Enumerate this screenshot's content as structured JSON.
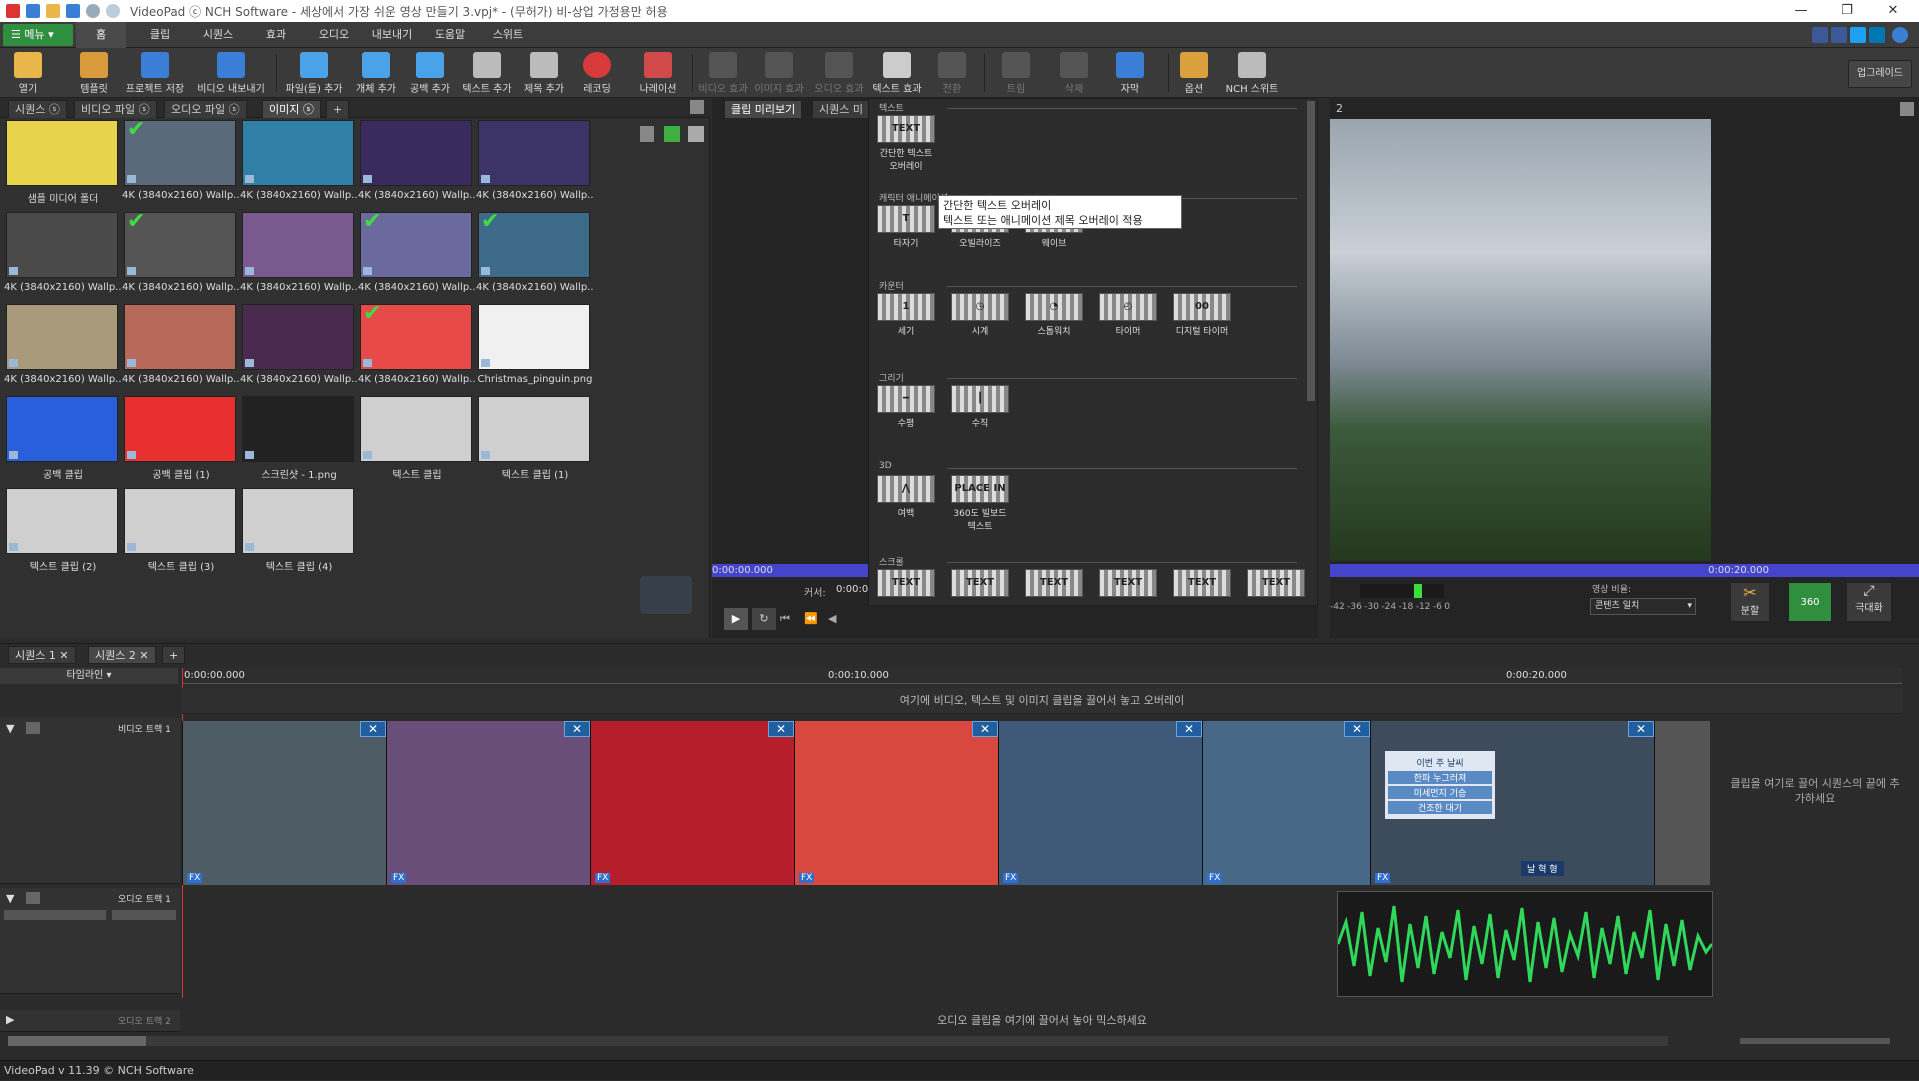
{
  "window": {
    "title": "VideoPad ⓒ NCH Software - 세상에서 가장 쉬운 영상 만들기 3.vpj* - (무허가) 비-상업 가정용만 허용",
    "controls": [
      "—",
      "❐",
      "✕"
    ]
  },
  "menu": {
    "main_button": "☰ 메뉴 ▾",
    "tabs": [
      "홈",
      "클립",
      "시퀀스",
      "효과",
      "오디오",
      "내보내기",
      "도움말",
      "스위트"
    ],
    "active_tab": "홈"
  },
  "toolbar": {
    "items": [
      {
        "label": "열기",
        "icon": "folder-open-icon",
        "color": "#e8b64a",
        "enabled": true
      },
      {
        "label": "템플릿",
        "icon": "template-icon",
        "color": "#d99a3b",
        "enabled": true
      },
      {
        "label": "프로젝트 저장",
        "icon": "save-icon",
        "color": "#3a7fd5",
        "enabled": true
      },
      {
        "label": "비디오 내보내기",
        "icon": "export-video-icon",
        "color": "#3a7fd5",
        "enabled": true
      },
      {
        "label": "파일(들) 추가",
        "icon": "add-files-icon",
        "color": "#4aa3e8",
        "enabled": true
      },
      {
        "label": "개체 추가",
        "icon": "add-object-icon",
        "color": "#4aa3e8",
        "enabled": true
      },
      {
        "label": "공백 추가",
        "icon": "add-blank-icon",
        "color": "#4aa3e8",
        "enabled": true
      },
      {
        "label": "텍스트 추가",
        "icon": "add-text-icon",
        "color": "#bbbbbb",
        "enabled": true
      },
      {
        "label": "제목 추가",
        "icon": "add-title-icon",
        "color": "#bbbbbb",
        "enabled": true
      },
      {
        "label": "레코딩",
        "icon": "record-icon",
        "color": "#d63a3a",
        "enabled": true
      },
      {
        "label": "나레이션",
        "icon": "narration-mic-icon",
        "color": "#d04a4a",
        "enabled": true
      },
      {
        "label": "비디오 효과",
        "icon": "video-effects-icon",
        "color": "#888888",
        "enabled": false
      },
      {
        "label": "이미지 효과",
        "icon": "image-effects-icon",
        "color": "#888888",
        "enabled": false
      },
      {
        "label": "오디오 효과",
        "icon": "audio-effects-icon",
        "color": "#888888",
        "enabled": false
      },
      {
        "label": "텍스트 효과",
        "icon": "text-effects-icon",
        "color": "#cccccc",
        "enabled": true
      },
      {
        "label": "전환",
        "icon": "transition-icon",
        "color": "#888888",
        "enabled": false
      },
      {
        "label": "트림",
        "icon": "trim-icon",
        "color": "#888888",
        "enabled": false
      },
      {
        "label": "삭제",
        "icon": "delete-icon",
        "color": "#888888",
        "enabled": false
      },
      {
        "label": "자막",
        "icon": "subtitle-icon",
        "color": "#3a7fd5",
        "enabled": true
      },
      {
        "label": "옵션",
        "icon": "options-icon",
        "color": "#d9a03b",
        "enabled": true
      },
      {
        "label": "NCH 스위트",
        "icon": "nch-suite-icon",
        "color": "#bbbbbb",
        "enabled": true
      }
    ],
    "upgrade_label": "업그레이드"
  },
  "bin": {
    "tabs": [
      {
        "label": "시퀀스",
        "count": "ⓢ"
      },
      {
        "label": "비디오 파일",
        "count": "ⓢ"
      },
      {
        "label": "오디오 파일",
        "count": "ⓢ"
      },
      {
        "label": "이미지",
        "count": "ⓢ"
      }
    ],
    "add_tab": "+",
    "items": [
      {
        "label": "샘플 미디어 폴더",
        "color": "#e8d44a",
        "checked": false
      },
      {
        "label": "4K (3840x2160) Wallp...",
        "color": "#5a6a7a",
        "checked": true
      },
      {
        "label": "4K (3840x2160) Wallp...",
        "color": "#2f7fa6",
        "checked": false
      },
      {
        "label": "4K (3840x2160) Wallp...",
        "color": "#3a2a5e",
        "checked": false
      },
      {
        "label": "4K (3840x2160) Wallp...",
        "color": "#3c3366",
        "checked": false
      },
      {
        "label": "4K (3840x2160) Wallp...",
        "color": "#4a4a4a",
        "checked": false
      },
      {
        "label": "4K (3840x2160) Wallp...",
        "color": "#555555",
        "checked": true
      },
      {
        "label": "4K (3840x2160) Wallp...",
        "color": "#7a5a8e",
        "checked": false
      },
      {
        "label": "4K (3840x2160) Wallp...",
        "color": "#6a6a9e",
        "checked": true
      },
      {
        "label": "4K (3840x2160) Wallp...",
        "color": "#3e6a8a",
        "checked": true
      },
      {
        "label": "4K (3840x2160) Wallp...",
        "color": "#a89a7a",
        "checked": false
      },
      {
        "label": "4K (3840x2160) Wallp...",
        "color": "#b86a5a",
        "checked": false
      },
      {
        "label": "4K (3840x2160) Wallp...",
        "color": "#4a2a4e",
        "checked": false
      },
      {
        "label": "4K (3840x2160) Wallp...",
        "color": "#e84a4a",
        "checked": true
      },
      {
        "label": "Christmas_pinguin.png",
        "color": "#f0f0f0",
        "checked": false
      },
      {
        "label": "공백 클립",
        "color": "#2a5fdc",
        "checked": false
      },
      {
        "label": "공백 클립 (1)",
        "color": "#e83030",
        "checked": false
      },
      {
        "label": "스크린샷 - 1.png",
        "color": "#222222",
        "checked": false
      },
      {
        "label": "텍스트 클립",
        "color": "#cfcfcf",
        "checked": false
      },
      {
        "label": "텍스트 클립 (1)",
        "color": "#cfcfcf",
        "checked": false
      },
      {
        "label": "텍스트 클립 (2)",
        "color": "#cfcfcf",
        "checked": false
      },
      {
        "label": "텍스트 클립 (3)",
        "color": "#cfcfcf",
        "checked": false
      },
      {
        "label": "텍스트 클립 (4)",
        "color": "#cfcfcf",
        "checked": false
      }
    ]
  },
  "preview": {
    "clip_tab": "클립 미리보기",
    "seq_tab": "시퀀스 미",
    "seq_number": "2",
    "clip_time_start": "0:00:00.000",
    "cursor_label": "커서:",
    "cursor_value": "0:00:0",
    "seq_time_end": "0:00:20.000",
    "ratio_label": "영상 비율:",
    "ratio_value": "콘텐츠 일치",
    "split_label": "분할",
    "btn_360": "360",
    "maximize_label": "극대화",
    "meter_ticks": [
      "-42",
      "-36",
      "-30",
      "-24",
      "-18",
      "-12",
      "-6",
      "0"
    ]
  },
  "effects": {
    "sections": [
      {
        "title": "텍스트",
        "items": [
          {
            "label": "간단한 텍스트 오버레이",
            "glyph": "TEXT"
          }
        ]
      },
      {
        "title": "캐릭터 애니메이션",
        "items": [
          {
            "label": "타자기",
            "glyph": "T"
          },
          {
            "label": "오빌라이즈",
            "glyph": ""
          },
          {
            "label": "웨이브",
            "glyph": ""
          }
        ]
      },
      {
        "title": "카운터",
        "items": [
          {
            "label": "세기",
            "glyph": "1"
          },
          {
            "label": "시계",
            "glyph": "◷"
          },
          {
            "label": "스톱워치",
            "glyph": "◔"
          },
          {
            "label": "타이머",
            "glyph": "◴"
          },
          {
            "label": "디지털 타이머",
            "glyph": "00"
          }
        ]
      },
      {
        "title": "그리기",
        "items": [
          {
            "label": "수평",
            "glyph": "━"
          },
          {
            "label": "수직",
            "glyph": "┃"
          }
        ]
      },
      {
        "title": "3D",
        "items": [
          {
            "label": "여백",
            "glyph": "⋀"
          },
          {
            "label": "360도 빌보드 텍스트",
            "glyph": "PLACE IN 360"
          }
        ]
      },
      {
        "title": "스크롤",
        "items": [
          {
            "label": "",
            "glyph": "TEXT"
          },
          {
            "label": "",
            "glyph": "TEXT"
          },
          {
            "label": "",
            "glyph": "TEXT"
          },
          {
            "label": "",
            "glyph": "TEXT"
          },
          {
            "label": "",
            "glyph": "TEXT"
          },
          {
            "label": "",
            "glyph": "TEXT"
          }
        ]
      }
    ],
    "tooltip_line1": "간단한 텍스트 오버레이",
    "tooltip_line2": "텍스트 또는 애니메이션 제목 오버레이 적용"
  },
  "timeline": {
    "tabs": [
      {
        "label": "시퀀스 1"
      },
      {
        "label": "시퀀스 2"
      }
    ],
    "add_tab": "+",
    "mode": "타임라인",
    "ruler": [
      "0:00:00.000",
      "0:00:10.000",
      "0:00:20.000"
    ],
    "overlay_hint": "여기에 비디오, 텍스트 및 이미지 클립을 끌어서 놓고 오버레이",
    "video_track": "비디오 트랙 1",
    "audio_track1": "오디오 트랙 1",
    "audio_track2": "오디오 트랙 2",
    "audio_hint": "오디오 클립을 여기에 끌어서 놓아 믹스하세요",
    "drop_hint": "클립을 여기로 끌어 시퀀스의 끝에 추가하세요",
    "clips": [
      {
        "color": "#4e5c66",
        "fx": "FX"
      },
      {
        "color": "#6a4e7a",
        "fx": "FX"
      },
      {
        "color": "#b51e2a",
        "fx": "FX"
      },
      {
        "color": "#d8483e",
        "fx": "FX"
      },
      {
        "color": "#3e5a78",
        "fx": "FX"
      },
      {
        "color": "#486888",
        "fx": "FX"
      },
      {
        "color": "#3c4c5c",
        "fx": "FX"
      },
      {
        "color": "#555555",
        "fx": ""
      }
    ],
    "news_lines": [
      "이번 주 날씨",
      "한파 누그러져",
      "미세먼지 기승",
      "건조한 대기"
    ],
    "news_name": "날 혁 형"
  },
  "status": {
    "text": "VideoPad v 11.39 © NCH Software"
  }
}
